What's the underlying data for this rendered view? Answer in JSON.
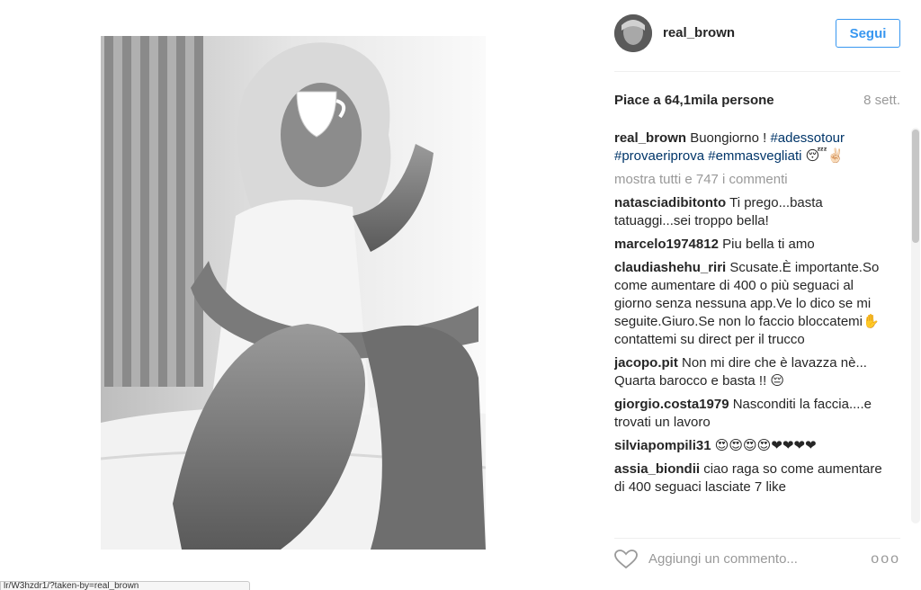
{
  "post": {
    "username": "real_brown",
    "follow_label": "Segui",
    "likes_text": "Piace a 64,1mila persone",
    "time_ago": "8 sett.",
    "caption": {
      "author": "real_brown",
      "text": "Buongiorno ! ",
      "tag1": "#adessotour",
      "tag2": "#provaeriprova",
      "tag3": "#emmasvegliati",
      "emoji": "😴✌🏻"
    },
    "show_all_comments": "mostra tutti e 747 i commenti",
    "comments": [
      {
        "author": "natasciadibitonto",
        "text": "Ti prego...basta tatuaggi...sei troppo bella!"
      },
      {
        "author": "marcelo1974812",
        "text": "Piu bella ti amo"
      },
      {
        "author": "claudiashehu_riri",
        "text": "Scusate.È importante.So come aumentare di 400 o più seguaci al giorno senza nessuna app.Ve lo dico se mi seguite.Giuro.Se non lo faccio bloccatemi✋contattemi su direct per il trucco"
      },
      {
        "author": "jacopo.pit",
        "text": "Non mi dire che è lavazza nè... Quarta barocco e basta !! 😔"
      },
      {
        "author": "giorgio.costa1979",
        "text": "Nasconditi la faccia....e trovati un lavoro"
      },
      {
        "author": "silviapompili31",
        "text": "😍😍😍😍❤❤❤❤"
      },
      {
        "author": "assia_biondii",
        "text": "ciao raga so come aumentare di 400 seguaci lasciate 7 like"
      }
    ],
    "comment_placeholder": "Aggiungi un commento...",
    "more_label": "ooo"
  },
  "status_bar": {
    "url": "lr/W3hzdr1/?taken-by=real_brown"
  },
  "icons": {
    "heart": "heart-outline-icon",
    "more": "more-options-icon"
  },
  "colors": {
    "accent": "#3897f0",
    "hashtag": "#003569",
    "muted": "#999999"
  }
}
